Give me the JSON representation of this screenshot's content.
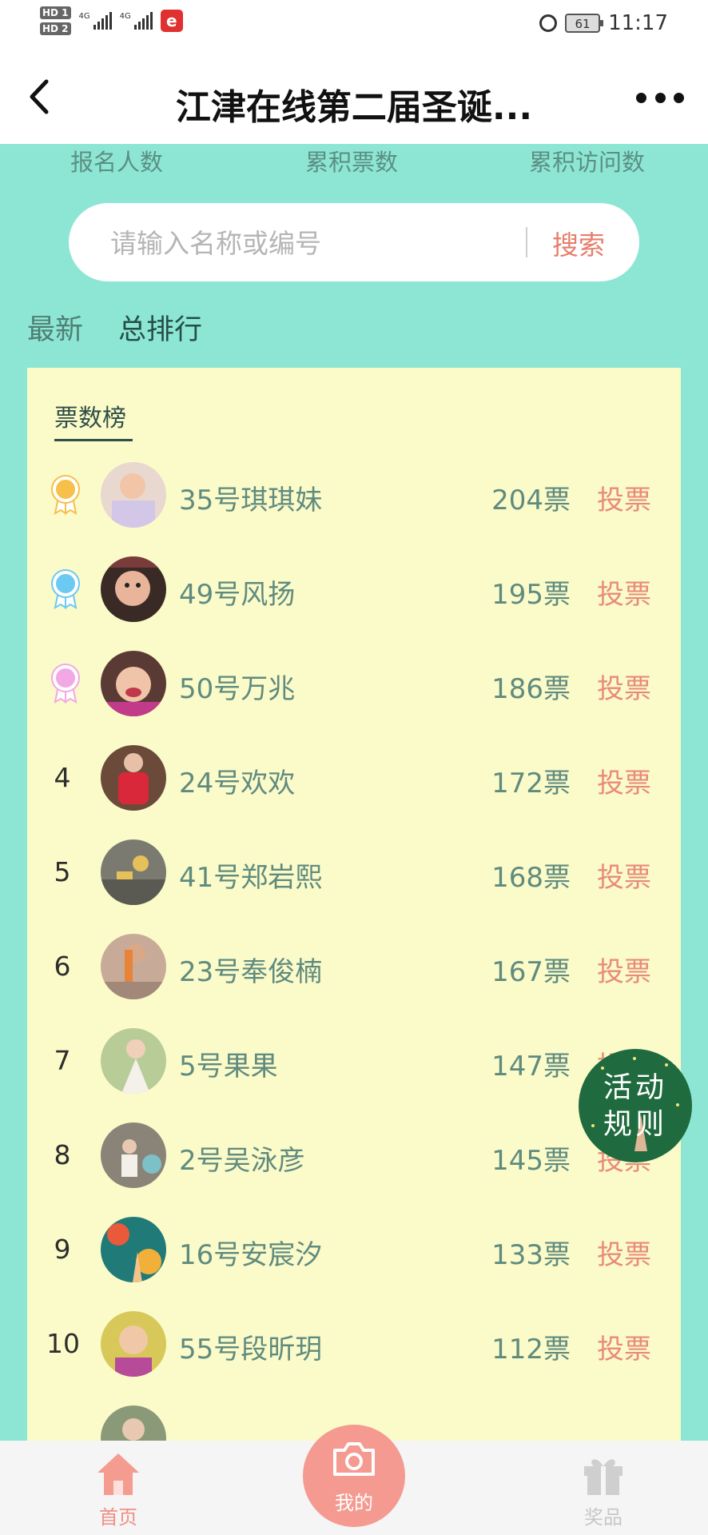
{
  "status_bar": {
    "hd1": "HD 1",
    "hd2": "HD 2",
    "net1": "4G",
    "net2": "4G",
    "battery": "61",
    "time": "11:17"
  },
  "header": {
    "title": "江津在线第二届圣诞..."
  },
  "stats": {
    "registrants": "报名人数",
    "total_votes": "累积票数",
    "total_visits": "累积访问数"
  },
  "search": {
    "placeholder": "请输入名称或编号",
    "button_label": "搜索"
  },
  "tabs": {
    "latest": "最新",
    "total_ranking": "总排行"
  },
  "leaderboard": {
    "title": "票数榜",
    "vote_label": "投票",
    "entries": [
      {
        "rank": "1",
        "name": "35号琪琪妹",
        "votes": "204票",
        "medal": "gold"
      },
      {
        "rank": "2",
        "name": "49号风扬",
        "votes": "195票",
        "medal": "blue"
      },
      {
        "rank": "3",
        "name": "50号万兆",
        "votes": "186票",
        "medal": "pink"
      },
      {
        "rank": "4",
        "name": "24号欢欢",
        "votes": "172票"
      },
      {
        "rank": "5",
        "name": "41号郑岩熙",
        "votes": "168票"
      },
      {
        "rank": "6",
        "name": "23号奉俊楠",
        "votes": "167票"
      },
      {
        "rank": "7",
        "name": "5号果果",
        "votes": "147票"
      },
      {
        "rank": "8",
        "name": "2号吴泳彦",
        "votes": "145票"
      },
      {
        "rank": "9",
        "name": "16号安宸汐",
        "votes": "133票"
      },
      {
        "rank": "10",
        "name": "55号段昕玥",
        "votes": "112票"
      }
    ]
  },
  "floating": {
    "rules_line1": "活动",
    "rules_line2": "规则"
  },
  "bottom_nav": {
    "home": "首页",
    "mine": "我的",
    "gift": "奖品"
  },
  "colors": {
    "background": "#8de6d4",
    "panel": "#fbfac9",
    "accent": "#e88b7c",
    "text_green": "#5f8b7f",
    "medal_gold": "#f6c04a",
    "medal_blue": "#6cc9f2",
    "medal_pink": "#f2a8e4"
  }
}
